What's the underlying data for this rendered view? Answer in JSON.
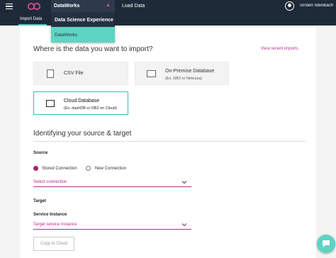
{
  "topbar": {
    "app_menu_label": "DataWorks",
    "nav_load_data": "Load Data",
    "user_name": "Torsten Steinbach"
  },
  "subnav": {
    "active_tab": "Import Data"
  },
  "app_dropdown": {
    "items": [
      {
        "label": "Data Science Experience"
      },
      {
        "label": "DataWorks"
      }
    ]
  },
  "import": {
    "heading": "Where is the data you want to import?",
    "view_recent": "View recent imports",
    "cards": {
      "csv": {
        "title": "CSV File"
      },
      "onprem": {
        "title": "On-Premise Database",
        "subtitle": "(Ex. DB2 or Netezza)"
      },
      "cloud": {
        "title": "Cloud Database",
        "subtitle": "(Ex. dashDB or DB2 on Cloud)"
      }
    }
  },
  "identify": {
    "heading": "Identifying your source & target",
    "source_label": "Source",
    "stored_connection": "Stored Connection",
    "new_connection": "New Connection",
    "selected_source_option": "Stored Connection",
    "select_connection_placeholder": "Select connection",
    "target_label": "Target",
    "service_instance_label": "Service Instance",
    "target_service_placeholder": "Target service instance",
    "copy_button": "Copy to Cloud"
  },
  "colors": {
    "topbar": "#1f2a38",
    "accent_magenta": "#a32475",
    "accent_teal": "#5ed4c2"
  }
}
